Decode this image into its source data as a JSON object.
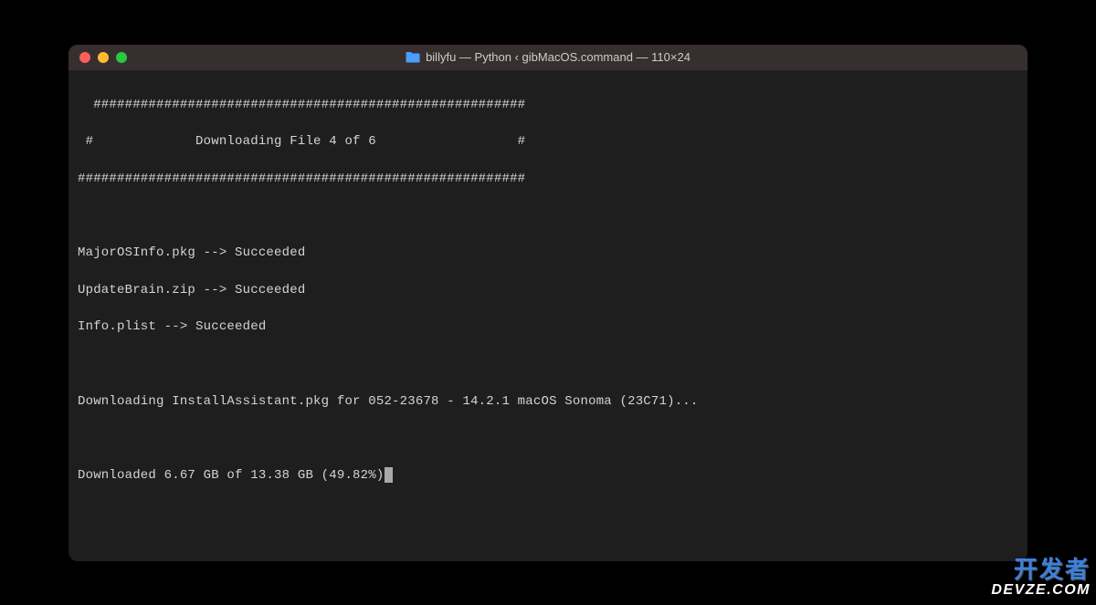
{
  "window": {
    "title": "billyfu — Python ‹ gibMacOS.command — 110×24"
  },
  "terminal": {
    "banner_top": "  #######################################################",
    "banner_middle": " #             Downloading File 4 of 6                  #",
    "banner_bottom": "#########################################################",
    "file1": "MajorOSInfo.pkg --> Succeeded",
    "file2": "UpdateBrain.zip --> Succeeded",
    "file3": "Info.plist --> Succeeded",
    "downloading": "Downloading InstallAssistant.pkg for 052-23678 - 14.2.1 macOS Sonoma (23C71)...",
    "progress": "Downloaded 6.67 GB of 13.38 GB (49.82%)"
  },
  "watermark": {
    "cn": "开发者",
    "en": "DEVZE.COM"
  }
}
